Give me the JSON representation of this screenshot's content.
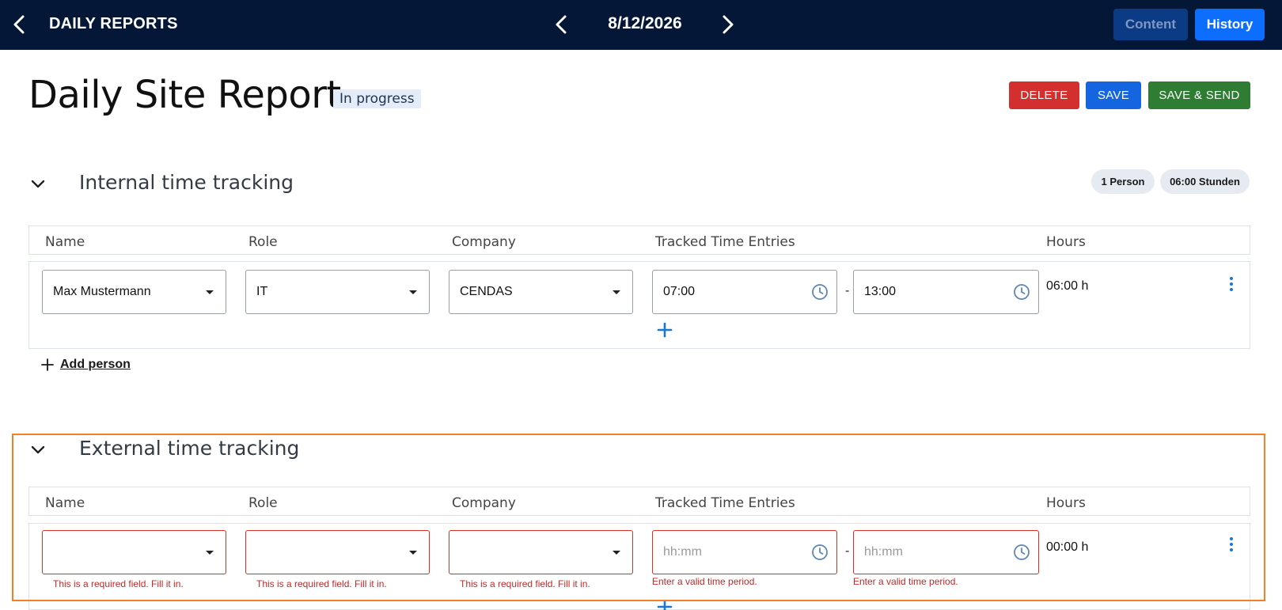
{
  "topbar": {
    "title": "DAILY REPORTS",
    "date": "8/12/2026",
    "content_label": "Content",
    "history_label": "History"
  },
  "header": {
    "title": "Daily Site Report",
    "status": "In progress",
    "delete_label": "DELETE",
    "save_label": "SAVE",
    "save_send_label": "SAVE & SEND"
  },
  "columns": {
    "name": "Name",
    "role": "Role",
    "company": "Company",
    "tracked": "Tracked Time Entries",
    "hours": "Hours"
  },
  "internal": {
    "title": "Internal time tracking",
    "persons_badge": "1 Person",
    "hours_badge": "06:00 Stunden",
    "row": {
      "name": "Max Mustermann",
      "role": "IT",
      "company": "CENDAS",
      "start": "07:00",
      "end": "13:00",
      "hours": "06:00 h"
    },
    "add_person_label": "Add person"
  },
  "external": {
    "title": "External time tracking",
    "row": {
      "start_placeholder": "hh:mm",
      "end_placeholder": "hh:mm",
      "hours": "00:00 h",
      "required_error": "This is a required field. Fill it in.",
      "time_error": "Enter a valid time period."
    }
  },
  "colors": {
    "topbar": "#041737",
    "history": "#0d6efd",
    "delete": "#d32f2f",
    "save": "#1565e0",
    "save_send": "#2e7d32",
    "error": "#d93025",
    "highlight": "#f47f24"
  }
}
